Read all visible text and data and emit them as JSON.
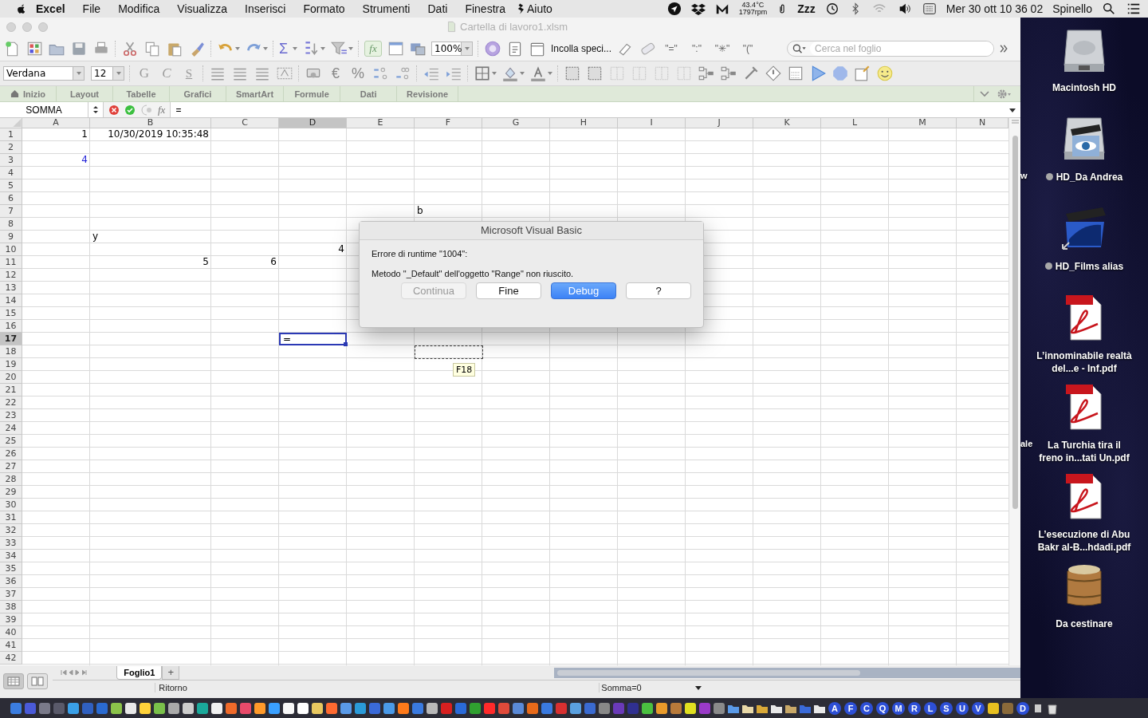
{
  "menu_bar": {
    "app": "Excel",
    "menus": [
      "File",
      "Modifica",
      "Visualizza",
      "Inserisci",
      "Formato",
      "Strumenti",
      "Dati",
      "Finestra",
      "Aiuto"
    ],
    "sensor": {
      "temperature": "43.4°C",
      "fan": "1797rpm"
    },
    "sleep": "Zzz",
    "clock": "Mer 30 ott  10 36 02",
    "user": "Spinello"
  },
  "window": {
    "title": "Cartella di lavoro1.xlsm"
  },
  "standard_toolbar": {
    "sum": "Σ",
    "function": "fx",
    "zoom": "100%",
    "paste_special": "Incolla speci...",
    "quotes": [
      "\"=\"",
      "\":\"",
      "\"✳\"",
      "\"(\""
    ],
    "search": {
      "placeholder": "Cerca nel foglio"
    }
  },
  "format_toolbar": {
    "font": "Verdana",
    "size": "12",
    "bold": "G",
    "italic": "C",
    "underline": "S",
    "currency": "€",
    "percent": "%"
  },
  "ribbon_tabs": [
    {
      "label": "Inizio",
      "selected": false
    },
    {
      "label": "Layout",
      "selected": false
    },
    {
      "label": "Tabelle",
      "selected": false
    },
    {
      "label": "Grafici",
      "selected": false
    },
    {
      "label": "SmartArt",
      "selected": false
    },
    {
      "label": "Formule",
      "selected": false
    },
    {
      "label": "Dati",
      "selected": false
    },
    {
      "label": "Revisione",
      "selected": false
    }
  ],
  "formula_bar": {
    "name_box": "SOMMA",
    "function": "fx",
    "value": "="
  },
  "sheet": {
    "columns": [
      {
        "label": "A",
        "selected": false
      },
      {
        "label": "B",
        "selected": false
      },
      {
        "label": "C",
        "selected": false
      },
      {
        "label": "D",
        "selected": true
      },
      {
        "label": "E",
        "selected": false
      },
      {
        "label": "F",
        "selected": false
      },
      {
        "label": "G",
        "selected": false
      },
      {
        "label": "H",
        "selected": false
      },
      {
        "label": "I",
        "selected": false
      },
      {
        "label": "J",
        "selected": false
      },
      {
        "label": "K",
        "selected": false
      },
      {
        "label": "L",
        "selected": false
      },
      {
        "label": "M",
        "selected": false
      },
      {
        "label": "N",
        "selected": false
      }
    ],
    "rows": [
      {
        "label": "1",
        "selected": false,
        "cells": [
          {
            "kind": "number",
            "text": "1"
          },
          {
            "kind": "number",
            "text": "10/30/2019 10:35:48"
          }
        ]
      },
      {
        "label": "2",
        "selected": false
      },
      {
        "label": "3",
        "selected": false,
        "cells": [
          {
            "kind": "number",
            "text": "4",
            "color": "#2323d8"
          }
        ]
      },
      {
        "label": "4",
        "selected": false
      },
      {
        "label": "5",
        "selected": false
      },
      {
        "label": "6",
        "selected": false
      },
      {
        "label": "7",
        "selected": false,
        "cells": [
          null,
          null,
          null,
          null,
          null,
          {
            "kind": "text",
            "text": "b"
          }
        ]
      },
      {
        "label": "8",
        "selected": false
      },
      {
        "label": "9",
        "selected": false,
        "cells": [
          null,
          {
            "kind": "text",
            "text": "y"
          }
        ]
      },
      {
        "label": "10",
        "selected": false,
        "cells": [
          null,
          null,
          null,
          {
            "kind": "number",
            "text": "4"
          }
        ]
      },
      {
        "label": "11",
        "selected": false,
        "cells": [
          null,
          {
            "kind": "number",
            "text": "5"
          },
          {
            "kind": "number",
            "text": "6"
          }
        ]
      },
      {
        "label": "12",
        "selected": false
      },
      {
        "label": "13",
        "selected": false
      },
      {
        "label": "14",
        "selected": false
      },
      {
        "label": "15",
        "selected": false
      },
      {
        "label": "16",
        "selected": false
      },
      {
        "label": "17",
        "selected": true,
        "cells": [
          null,
          null,
          null,
          {
            "kind": "editing",
            "text": "="
          }
        ]
      },
      {
        "label": "18",
        "selected": false
      },
      {
        "label": "19",
        "selected": false
      },
      {
        "label": "20",
        "selected": false
      },
      {
        "label": "21",
        "selected": false
      },
      {
        "label": "22",
        "selected": false
      },
      {
        "label": "23",
        "selected": false
      },
      {
        "label": "24",
        "selected": false
      },
      {
        "label": "25",
        "selected": false
      },
      {
        "label": "26",
        "selected": false
      },
      {
        "label": "27",
        "selected": false
      },
      {
        "label": "28",
        "selected": false
      },
      {
        "label": "29",
        "selected": false
      },
      {
        "label": "30",
        "selected": false
      },
      {
        "label": "31",
        "selected": false
      },
      {
        "label": "32",
        "selected": false
      },
      {
        "label": "33",
        "selected": false
      },
      {
        "label": "34",
        "selected": false
      },
      {
        "label": "35",
        "selected": false
      },
      {
        "label": "36",
        "selected": false
      },
      {
        "label": "37",
        "selected": false
      },
      {
        "label": "38",
        "selected": false
      },
      {
        "label": "39",
        "selected": false
      },
      {
        "label": "40",
        "selected": false
      },
      {
        "label": "41",
        "selected": false
      },
      {
        "label": "42",
        "selected": false
      }
    ],
    "copy_tooltip": "F18"
  },
  "dialog": {
    "title": "Microsoft Visual Basic",
    "lines": [
      "Errore di runtime \"1004\":",
      "Metodo \"_Default\" dell'oggetto \"Range\" non riuscito."
    ],
    "buttons": [
      {
        "label": "Continua",
        "disabled": true,
        "default": false
      },
      {
        "label": "Fine",
        "disabled": false,
        "default": false
      },
      {
        "label": "Debug",
        "disabled": false,
        "default": true
      },
      {
        "label": "?",
        "disabled": false,
        "default": false
      }
    ]
  },
  "sheet_tabs": [
    {
      "label": "Foglio1",
      "selected": true
    }
  ],
  "add_sheet": "+",
  "status_bar": {
    "mode": "Ritorno",
    "summary": "Somma=0"
  },
  "desktop": {
    "partial_labels": [
      "w",
      "ale"
    ],
    "icons": [
      {
        "kind": "drive",
        "label": "Macintosh HD",
        "tagged": false
      },
      {
        "kind": "movie-drive",
        "label": "HD_Da Andrea",
        "tagged": true
      },
      {
        "kind": "movie",
        "label": "HD_Films alias",
        "tagged": true
      },
      {
        "kind": "pdf",
        "label": "L’innominabile realtà del...e - Inf.pdf",
        "tagged": false
      },
      {
        "kind": "pdf",
        "label": "La Turchia tira il freno in...tati Un.pdf",
        "tagged": false
      },
      {
        "kind": "pdf",
        "label": "L’esecuzione di Abu Bakr al-B...hdadi.pdf",
        "tagged": false
      },
      {
        "kind": "barrel",
        "label": "Da cestinare",
        "tagged": false
      }
    ]
  },
  "dock": {
    "letters": [
      "A",
      "F",
      "C",
      "Q",
      "M",
      "R",
      "L",
      "S",
      "U",
      "V",
      "D"
    ]
  }
}
